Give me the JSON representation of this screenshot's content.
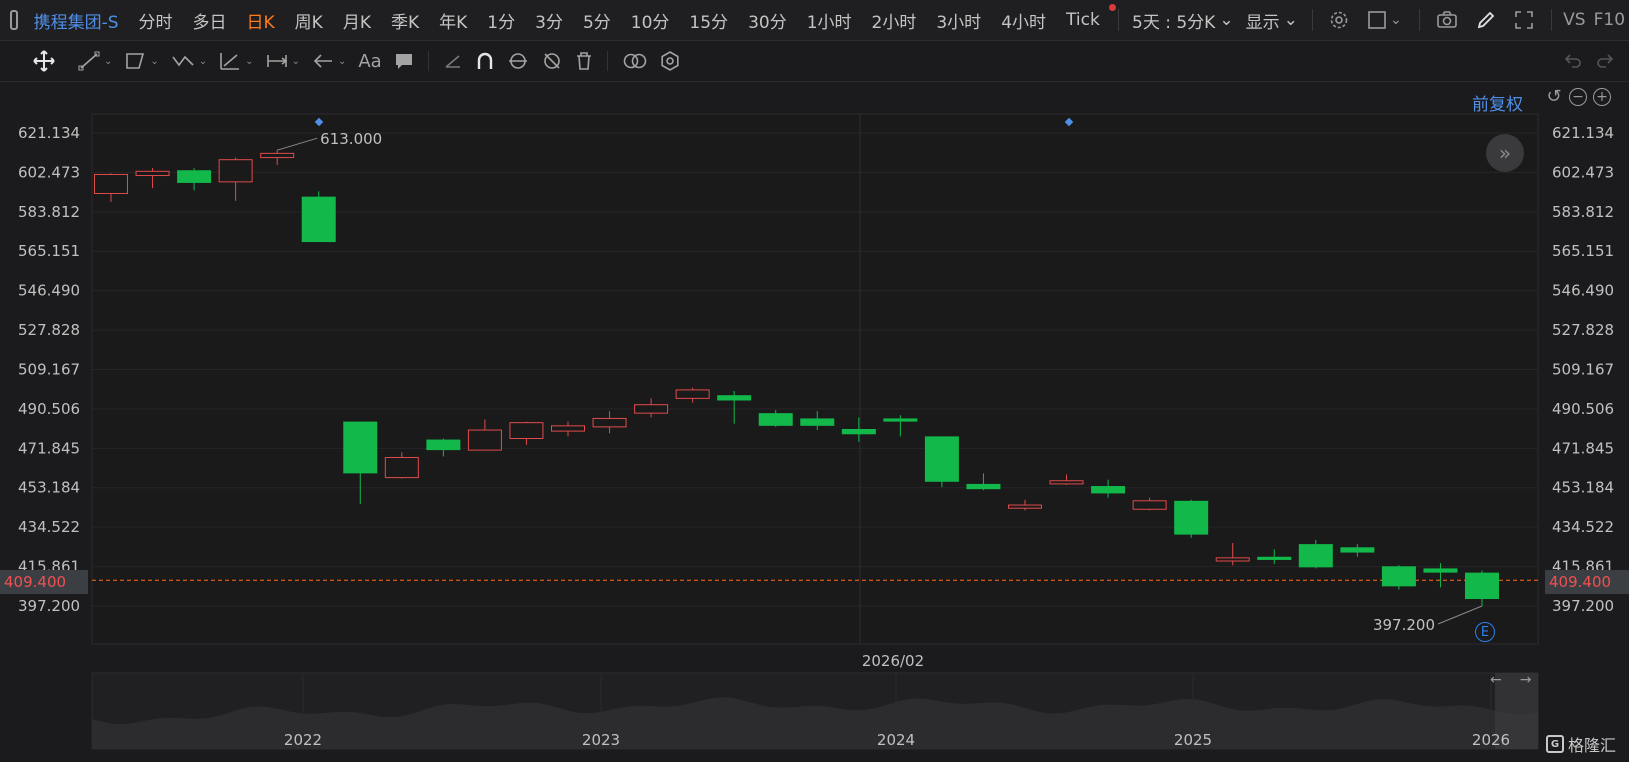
{
  "header": {
    "symbol": "携程集团-S",
    "timeframes": [
      "分时",
      "多日",
      "日K",
      "周K",
      "月K",
      "季K",
      "年K",
      "1分",
      "3分",
      "5分",
      "10分",
      "15分",
      "30分",
      "1小时",
      "2小时",
      "3小时",
      "4小时",
      "Tick"
    ],
    "active_timeframe": "日K",
    "multi_day": "5天 : 5分K",
    "display": "显示",
    "vs": "VS",
    "f10": "F10"
  },
  "chart": {
    "adjust_label": "前复权",
    "current_price": "409.400",
    "high_label": "613.000",
    "low_label": "397.200",
    "crosshair_date": "2026/02",
    "event_badge": "E",
    "price_axis": [
      "621.134",
      "602.473",
      "583.812",
      "565.151",
      "546.490",
      "527.828",
      "509.167",
      "490.506",
      "471.845",
      "453.184",
      "434.522",
      "415.861",
      "397.200"
    ],
    "navigator_years": [
      "2022",
      "2023",
      "2024",
      "2025",
      "2026"
    ],
    "colors": {
      "up": "#e04b4b",
      "down": "#12b84a",
      "accent": "#4f8fe8",
      "price_line": "#ff6a1a"
    }
  },
  "brand": "格隆汇",
  "chart_data": {
    "type": "candlestick",
    "ylim": [
      397.2,
      621.134
    ],
    "candles": [
      {
        "o": 592.5,
        "c": 601.5,
        "h": 602.0,
        "l": 588.5
      },
      {
        "o": 601.0,
        "c": 603.0,
        "h": 604.5,
        "l": 595.0
      },
      {
        "o": 603.5,
        "c": 597.5,
        "h": 604.5,
        "l": 594.0
      },
      {
        "o": 598.0,
        "c": 608.5,
        "h": 609.5,
        "l": 589.0
      },
      {
        "o": 609.5,
        "c": 611.5,
        "h": 613.0,
        "l": 606.0
      },
      {
        "o": 591.0,
        "c": 569.5,
        "h": 593.5,
        "l": 569.5
      },
      {
        "o": 484.5,
        "c": 460.0,
        "h": 484.5,
        "l": 445.5
      },
      {
        "o": 458.0,
        "c": 467.5,
        "h": 470.0,
        "l": 457.5
      },
      {
        "o": 476.0,
        "c": 471.0,
        "h": 476.5,
        "l": 468.0
      },
      {
        "o": 471.0,
        "c": 480.5,
        "h": 485.5,
        "l": 471.0
      },
      {
        "o": 476.5,
        "c": 484.0,
        "h": 484.5,
        "l": 473.5
      },
      {
        "o": 480.0,
        "c": 482.5,
        "h": 484.5,
        "l": 477.5
      },
      {
        "o": 482.0,
        "c": 486.0,
        "h": 489.5,
        "l": 479.0
      },
      {
        "o": 488.5,
        "c": 492.5,
        "h": 495.5,
        "l": 486.5
      },
      {
        "o": 495.5,
        "c": 499.5,
        "h": 500.5,
        "l": 493.5
      },
      {
        "o": 497.0,
        "c": 494.5,
        "h": 499.0,
        "l": 483.5
      },
      {
        "o": 488.5,
        "c": 482.5,
        "h": 490.0,
        "l": 482.0
      },
      {
        "o": 486.0,
        "c": 482.5,
        "h": 489.5,
        "l": 480.5
      },
      {
        "o": 481.0,
        "c": 478.5,
        "h": 486.5,
        "l": 475.0
      },
      {
        "o": 486.0,
        "c": 484.5,
        "h": 487.5,
        "l": 477.5
      },
      {
        "o": 477.5,
        "c": 456.0,
        "h": 477.5,
        "l": 453.5
      },
      {
        "o": 455.0,
        "c": 452.5,
        "h": 460.0,
        "l": 452.0
      },
      {
        "o": 443.5,
        "c": 445.0,
        "h": 447.5,
        "l": 442.5
      },
      {
        "o": 455.0,
        "c": 456.5,
        "h": 459.5,
        "l": 454.5
      },
      {
        "o": 454.0,
        "c": 450.5,
        "h": 457.0,
        "l": 448.5
      },
      {
        "o": 443.0,
        "c": 447.0,
        "h": 448.5,
        "l": 442.5
      },
      {
        "o": 447.0,
        "c": 431.0,
        "h": 447.5,
        "l": 429.5
      },
      {
        "o": 418.5,
        "c": 420.0,
        "h": 427.0,
        "l": 416.5
      },
      {
        "o": 420.5,
        "c": 419.0,
        "h": 424.0,
        "l": 417.0
      },
      {
        "o": 426.5,
        "c": 415.5,
        "h": 428.5,
        "l": 415.0
      },
      {
        "o": 425.0,
        "c": 422.5,
        "h": 426.5,
        "l": 420.5
      },
      {
        "o": 416.0,
        "c": 406.5,
        "h": 416.5,
        "l": 405.0
      },
      {
        "o": 415.0,
        "c": 413.0,
        "h": 417.5,
        "l": 406.0
      },
      {
        "o": 413.0,
        "c": 400.5,
        "h": 414.0,
        "l": 397.2
      }
    ]
  }
}
